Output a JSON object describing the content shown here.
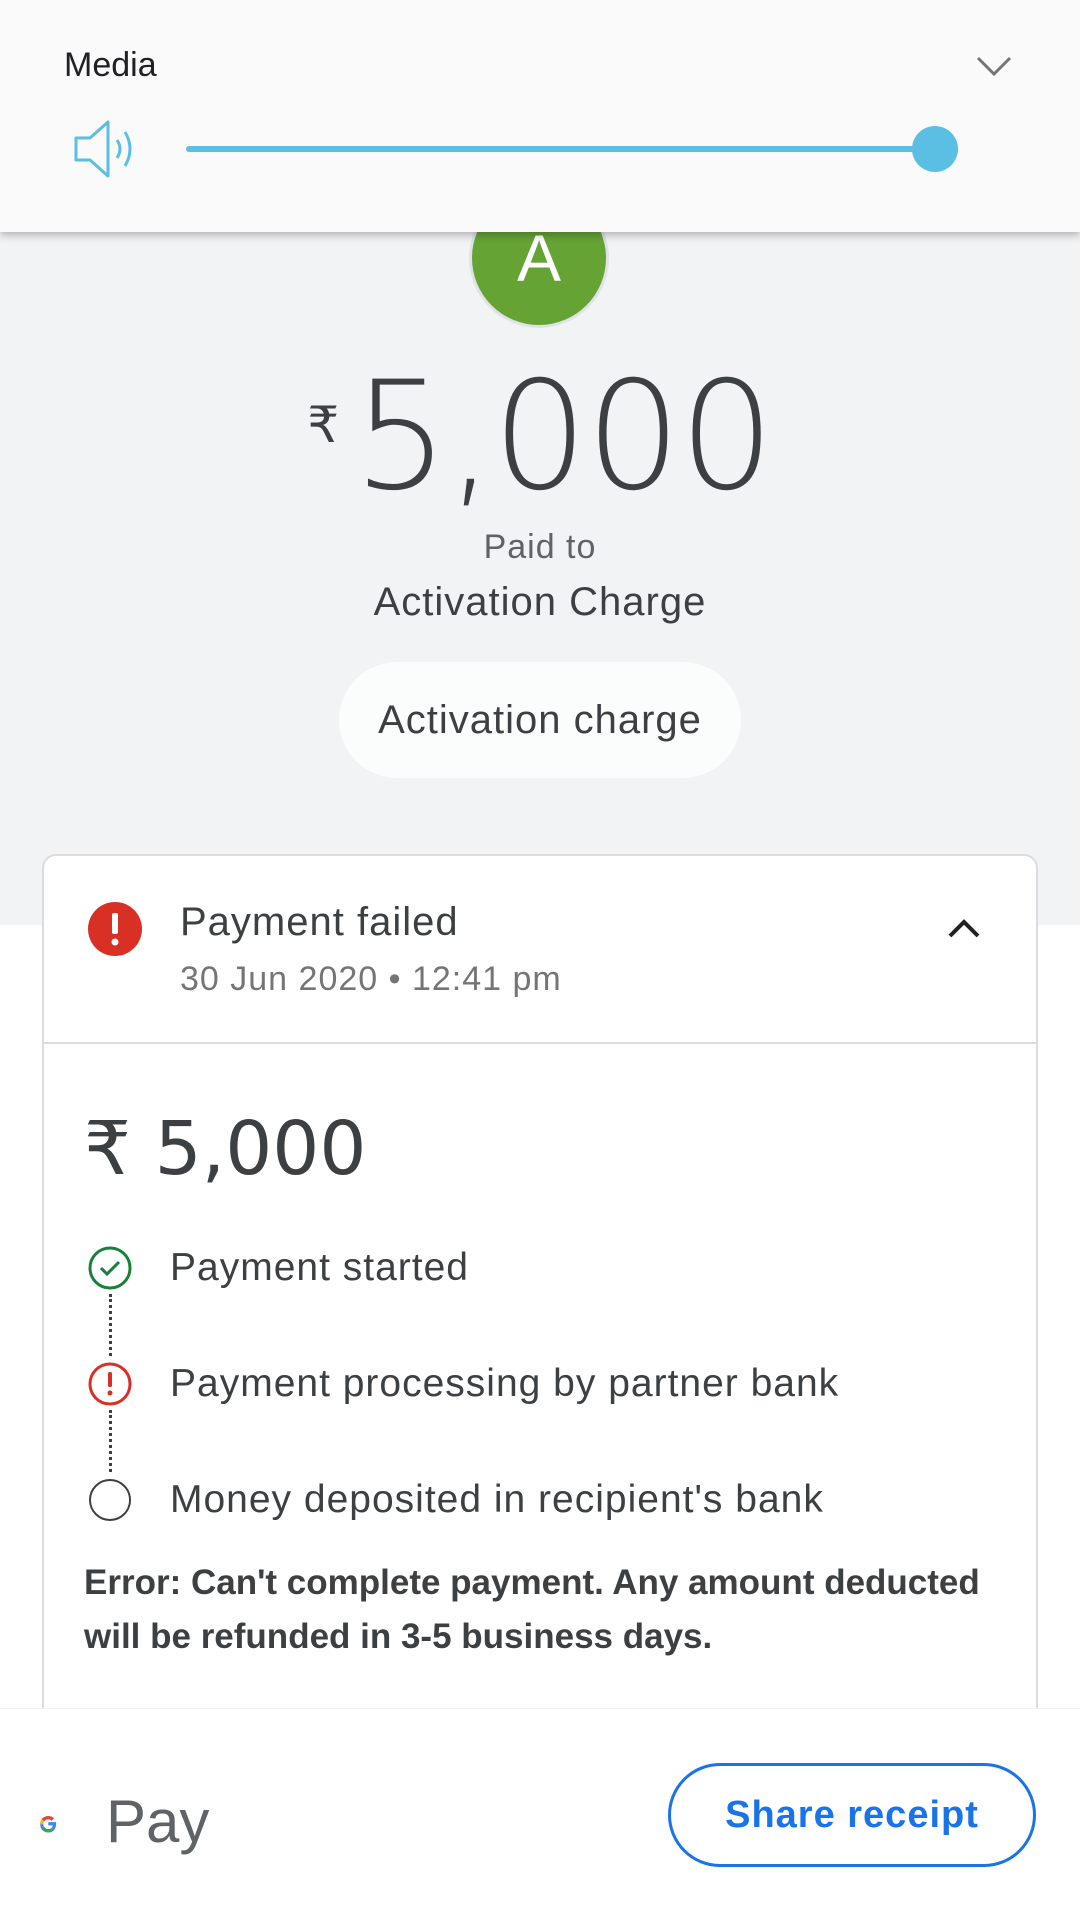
{
  "media_panel": {
    "title": "Media",
    "volume_level": 1.0,
    "icons": [
      "speaker-icon",
      "chevron-down-icon"
    ],
    "accent_color": "#5bbfe3"
  },
  "payee": {
    "avatar_letter": "A",
    "avatar_color": "#66a335",
    "currency_symbol": "₹",
    "amount": "5,000",
    "paid_to_label": "Paid to",
    "name": "Activation Charge",
    "note": "Activation charge"
  },
  "status_card": {
    "title": "Payment failed",
    "timestamp": "30 Jun 2020 • 12:41 pm",
    "amount": "₹ 5,000",
    "steps": [
      {
        "label": "Payment started",
        "state": "done",
        "icon": "check-circle-icon"
      },
      {
        "label": "Payment processing by partner bank",
        "state": "error",
        "icon": "error-circle-icon"
      },
      {
        "label": "Money deposited in recipient's bank",
        "state": "pending",
        "icon": "empty-circle-icon"
      }
    ],
    "error_message": "Error: Can't complete payment. Any amount deducted will be refunded in 3-5 business days.",
    "error_color": "#d93025",
    "success_color": "#188038"
  },
  "footer": {
    "brand_text": "Pay",
    "share_label": "Share receipt",
    "button_color": "#1a73e8"
  }
}
